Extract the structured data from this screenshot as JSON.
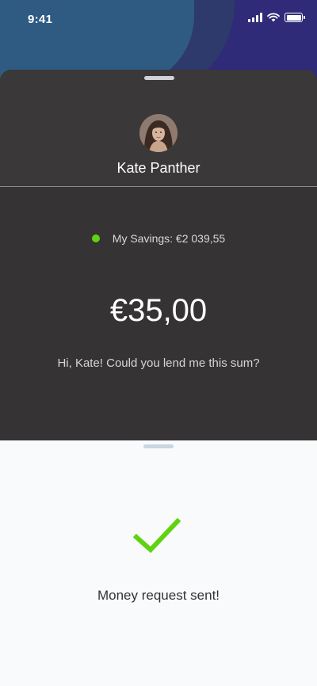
{
  "status_bar": {
    "time": "9:41",
    "icons": [
      "signal-icon",
      "wifi-icon",
      "battery-icon"
    ]
  },
  "contact": {
    "name": "Kate Panther",
    "avatar": "avatar-photo"
  },
  "savings": {
    "label": "My Savings: €2 039,55",
    "status_color": "#5fd311"
  },
  "request": {
    "amount": "€35,00",
    "message": "Hi, Kate! Could you lend me this sum?"
  },
  "confirmation": {
    "icon": "checkmark-icon",
    "text": "Money request sent!",
    "accent_color": "#5fd311"
  },
  "colors": {
    "sheet_background": "#353333",
    "page_background": "#f8fafc"
  }
}
